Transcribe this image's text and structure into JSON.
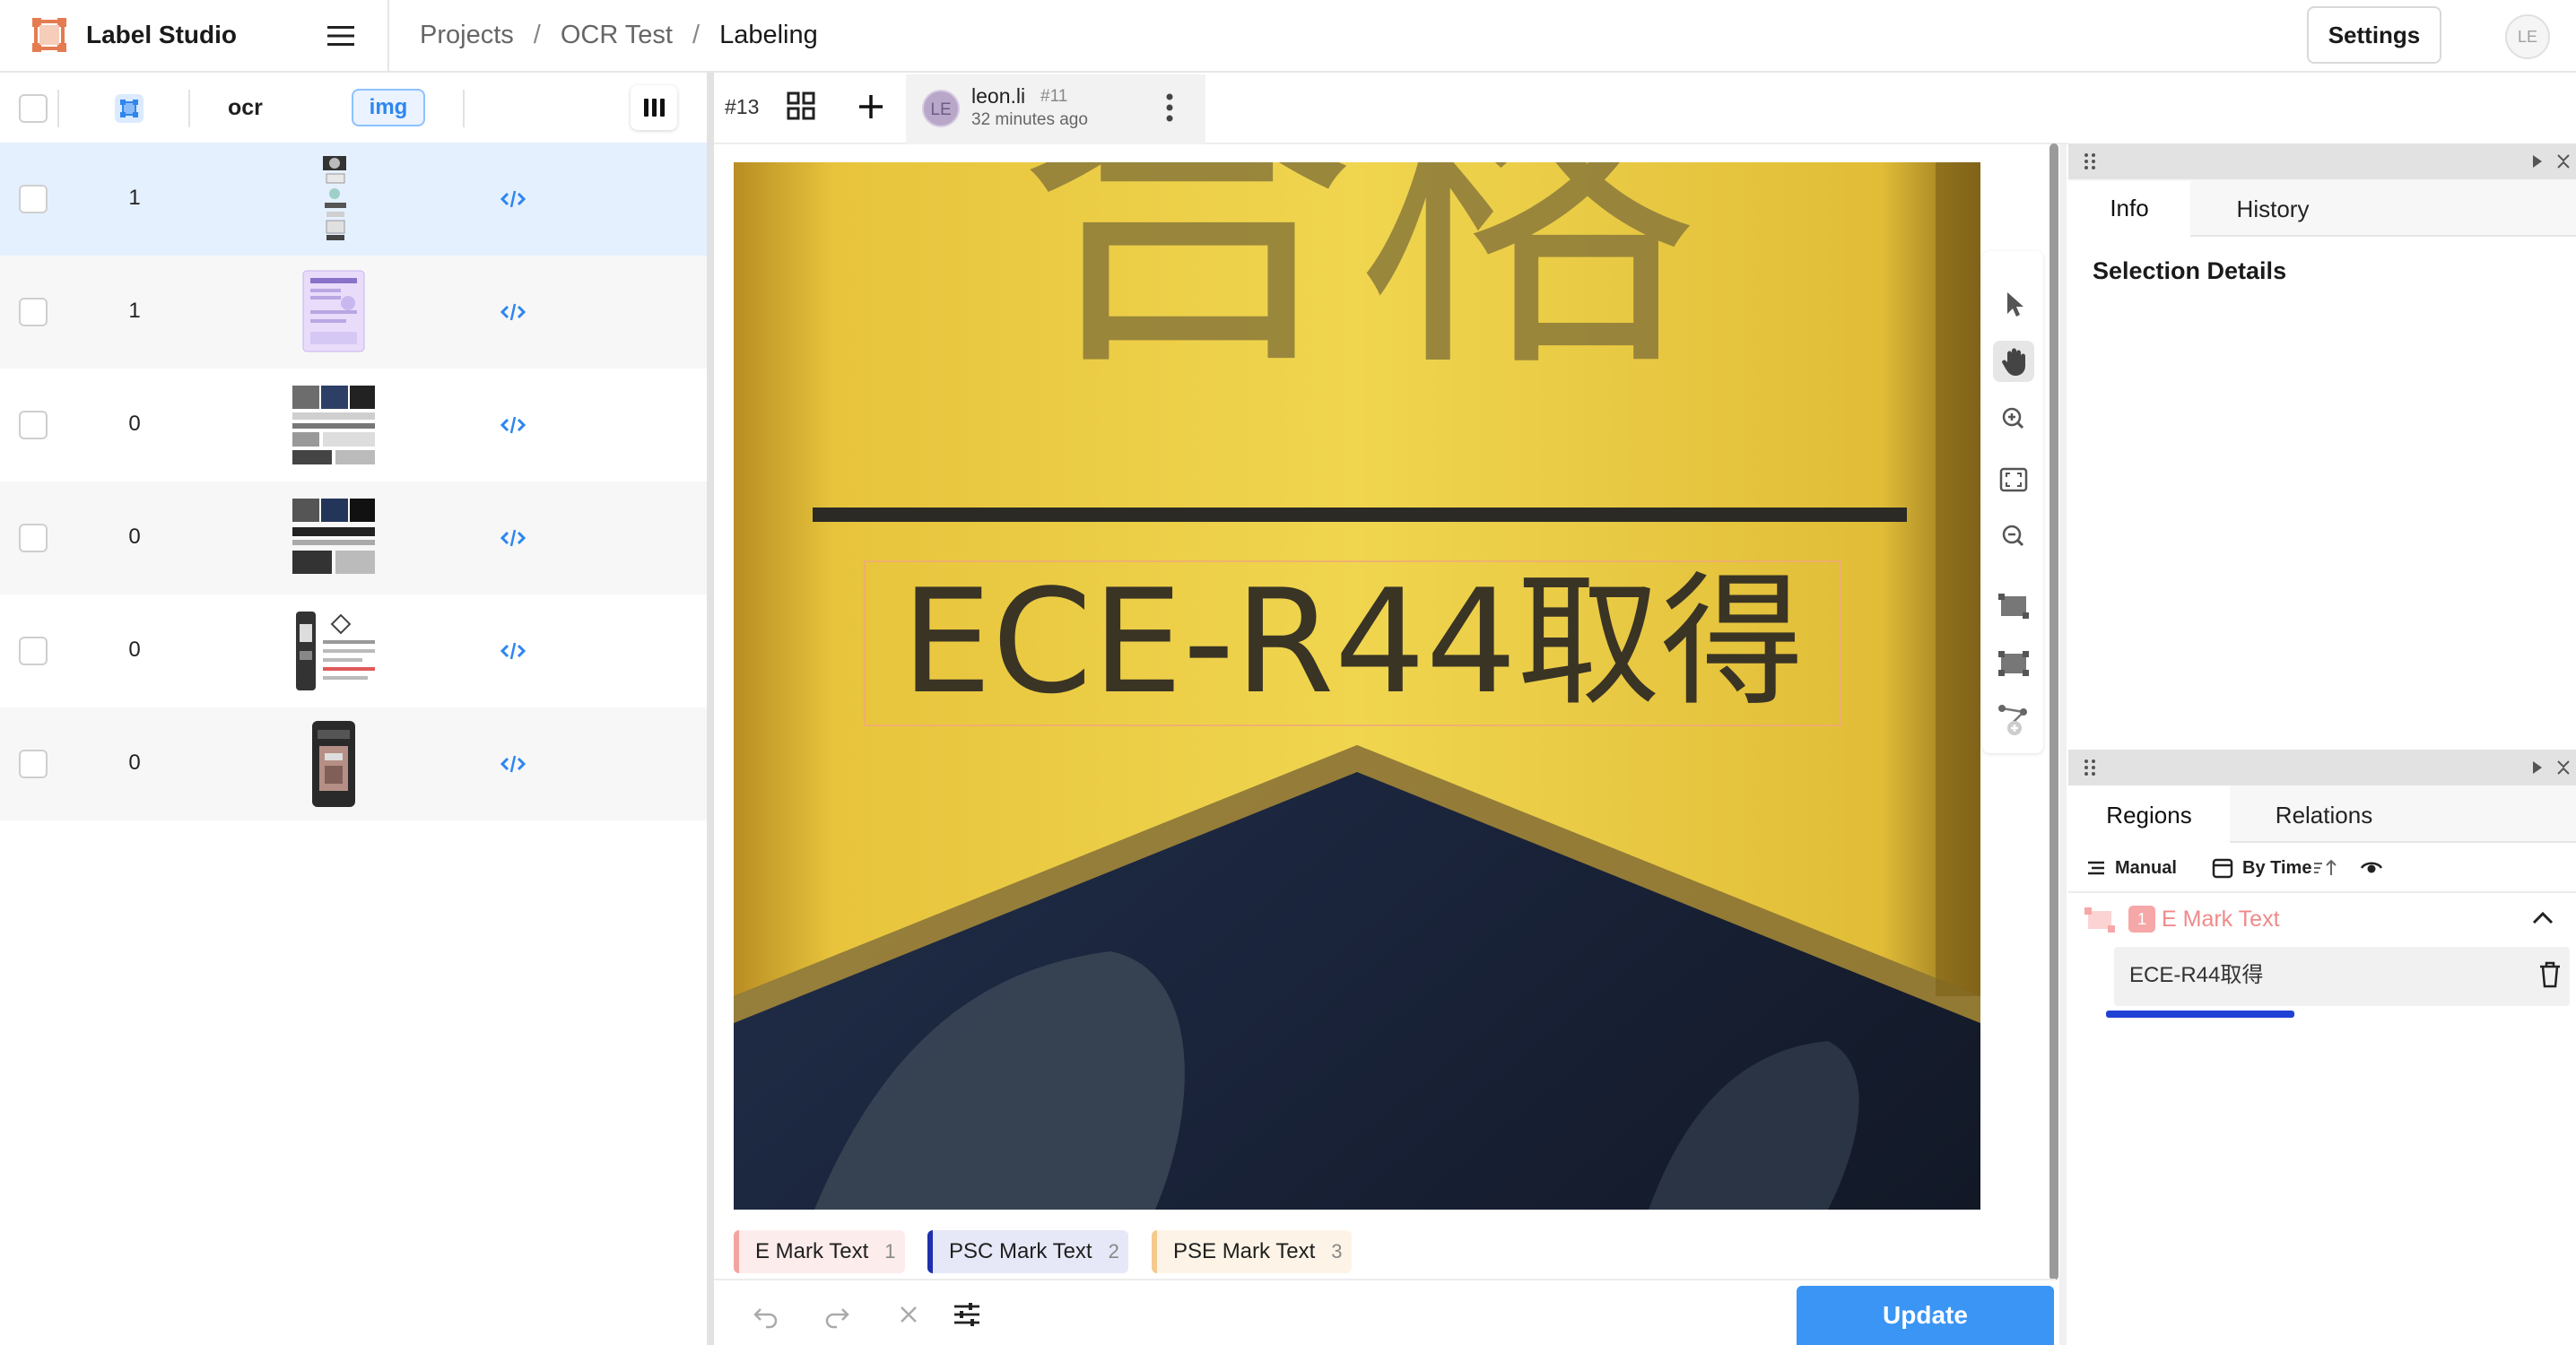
{
  "header": {
    "app_title": "Label Studio",
    "breadcrumb": [
      "Projects",
      "/",
      "OCR Test",
      "/",
      "Labeling"
    ],
    "settings_label": "Settings",
    "user_initials": "LE"
  },
  "table": {
    "columns": {
      "col2": "ocr",
      "col3": "img"
    },
    "rows": [
      {
        "count": "1",
        "selected": true
      },
      {
        "count": "1",
        "selected": false
      },
      {
        "count": "0",
        "selected": false
      },
      {
        "count": "0",
        "selected": false
      },
      {
        "count": "0",
        "selected": false
      },
      {
        "count": "0",
        "selected": false
      }
    ]
  },
  "annotation": {
    "task_id": "#13",
    "user": "leon.li",
    "annotation_id": "#11",
    "time": "32 minutes ago",
    "avatar_initials": "LE"
  },
  "canvas": {
    "image_text_top": "合格",
    "image_text_main": "ECE-R44取得"
  },
  "labels": [
    {
      "name": "E Mark Text",
      "hotkey": "1",
      "color": "#f4a3a3"
    },
    {
      "name": "PSC Mark Text",
      "hotkey": "2",
      "color": "#1f2fae"
    },
    {
      "name": "PSE Mark Text",
      "hotkey": "3",
      "color": "#f5c98d"
    }
  ],
  "actions": {
    "update_label": "Update"
  },
  "info_panel": {
    "tabs": [
      "Info",
      "History"
    ],
    "active_tab": "Info",
    "selection_title": "Selection Details"
  },
  "regions_panel": {
    "tabs": [
      "Regions",
      "Relations"
    ],
    "active_tab": "Regions",
    "group_label": "Manual",
    "order_label": "By Time",
    "region": {
      "index": "1",
      "label": "E Mark Text",
      "text": "ECE-R44取得"
    }
  },
  "colors": {
    "accent": "#3a95f5",
    "selected_row": "#e5f0ff",
    "region_label": "#f08a8a"
  }
}
